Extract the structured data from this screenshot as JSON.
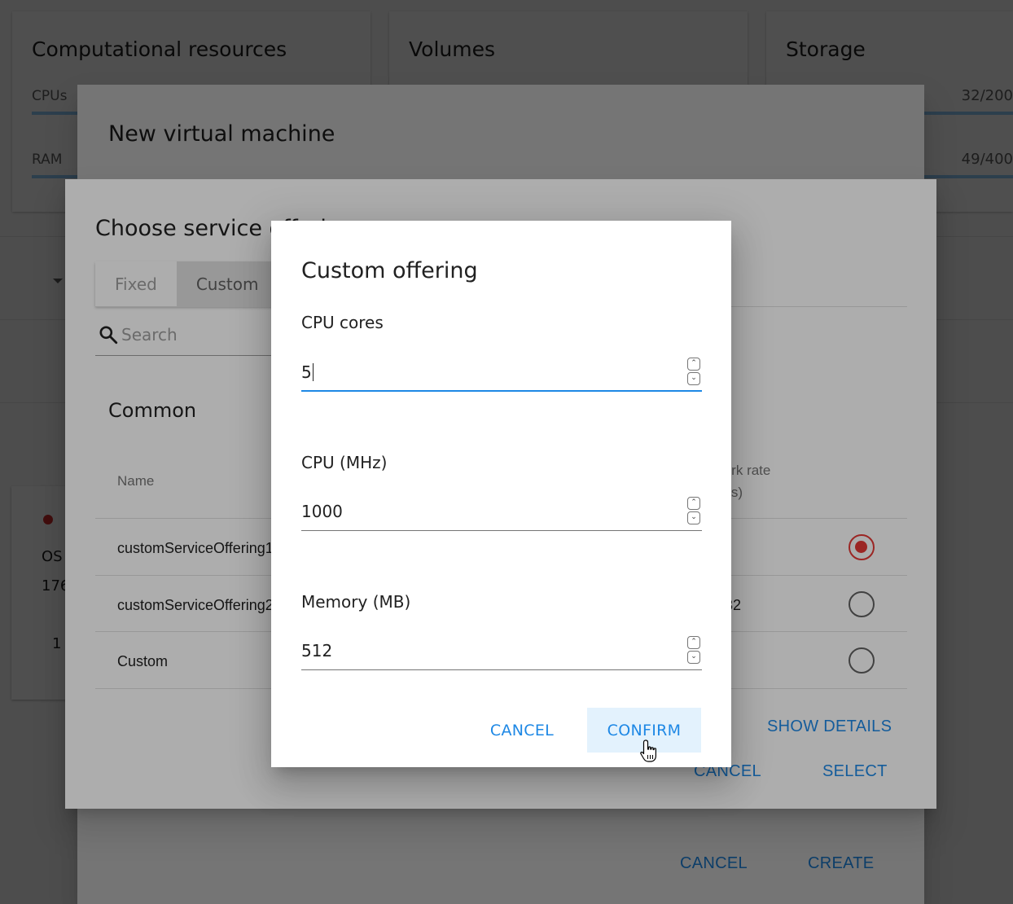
{
  "resources": {
    "computational": {
      "title": "Computational resources",
      "cpus_label": "CPUs",
      "ram_label": "RAM"
    },
    "volumes": {
      "title": "Volumes"
    },
    "storage": {
      "title": "Storage",
      "value1": "32/200",
      "value2": "49/400"
    }
  },
  "vm_card": {
    "os_prefix": "OS",
    "ip_prefix": "176",
    "other_prefix": "1"
  },
  "new_vm_dialog": {
    "title": "New virtual machine",
    "cancel_label": "CANCEL",
    "create_label": "CREATE"
  },
  "service_dialog": {
    "title": "Choose service offering",
    "tabs": [
      {
        "label": "Fixed"
      },
      {
        "label": "Custom"
      }
    ],
    "search_placeholder": "Search",
    "section_title": "Common",
    "columns": {
      "name": "Name",
      "network_rate_line1": "Network rate",
      "network_rate_line2": "(MB/s)"
    },
    "rows": [
      {
        "name": "customServiceOffering1",
        "network_rate": "",
        "selected": true
      },
      {
        "name": "customServiceOffering2",
        "network_rate": "32",
        "selected": false
      },
      {
        "name": "Custom",
        "network_rate": "",
        "selected": false
      }
    ],
    "show_details_label": "SHOW DETAILS",
    "cancel_label": "CANCEL",
    "select_label": "SELECT"
  },
  "custom_offering_dialog": {
    "title": "Custom offering",
    "fields": [
      {
        "label": "CPU cores",
        "value": "5"
      },
      {
        "label": "CPU (MHz)",
        "value": "1000"
      },
      {
        "label": "Memory (MB)",
        "value": "512"
      }
    ],
    "cancel_label": "CANCEL",
    "confirm_label": "CONFIRM"
  },
  "colors": {
    "accent": "#1e88e5",
    "radio_selected": "#e53935",
    "status_dot": "#d32f2f",
    "bar": "#90caf9"
  },
  "icons": {
    "search": "search-icon",
    "cursor": "hand-pointer-icon",
    "spinner_up": "chevron-up-icon",
    "spinner_down": "chevron-down-icon"
  }
}
